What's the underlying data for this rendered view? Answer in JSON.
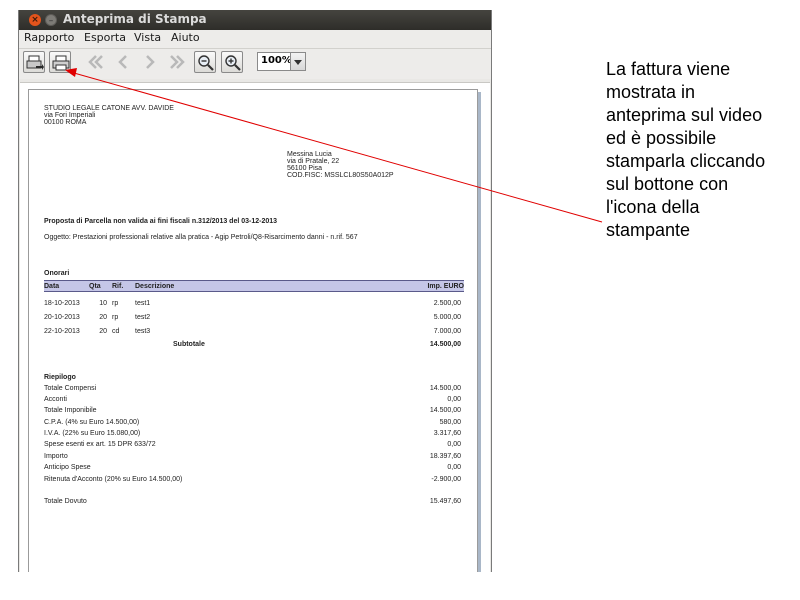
{
  "window": {
    "title": "Anteprima di Stampa"
  },
  "menubar": {
    "items": [
      "Rapporto",
      "Esporta",
      "Vista",
      "Aiuto"
    ]
  },
  "toolbar": {
    "buttons": [
      "export-icon",
      "print-icon",
      "first-page-icon",
      "prev-page-icon",
      "next-page-icon",
      "last-page-icon",
      "zoom-out-icon",
      "zoom-in-icon"
    ],
    "zoom": "100%"
  },
  "document": {
    "sender": {
      "name": "STUDIO LEGALE CATONE AVV. DAVIDE",
      "address": "via Fori Imperiali",
      "city": "00100 ROMA"
    },
    "recipient": {
      "name": "Messina Lucia",
      "address": "via di Pratale, 22",
      "city": "56100 Pisa",
      "tax_code": "COD.FISC: MSSLCL80S50A012P"
    },
    "heading": "Proposta di Parcella non valida ai fini fiscali n.312/2013 del 03-12-2013",
    "subject": "Oggetto: Prestazioni professionali relative alla pratica - Agip Petroli/Q8-Risarcimento danni  - n.rif. 567",
    "onorari": {
      "section_title": "Onorari",
      "columns": [
        "Data",
        "Qta",
        "Rif.",
        "Descrizione",
        "Imp. EURO"
      ],
      "rows": [
        {
          "data": "18-10-2013",
          "qta": "10",
          "rif": "rp",
          "descrizione": "test1",
          "importo": "2.500,00"
        },
        {
          "data": "20-10-2013",
          "qta": "20",
          "rif": "rp",
          "descrizione": "test2",
          "importo": "5.000,00"
        },
        {
          "data": "22-10-2013",
          "qta": "20",
          "rif": "cd",
          "descrizione": "test3",
          "importo": "7.000,00"
        }
      ],
      "subtotal_label": "Subtotale",
      "subtotal_value": "14.500,00"
    },
    "riepilogo": {
      "section_title": "Riepilogo",
      "rows": [
        {
          "label": "Totale Compensi",
          "value": "14.500,00"
        },
        {
          "label": "Acconti",
          "value": "0,00"
        },
        {
          "label": "Totale Imponibile",
          "value": "14.500,00"
        },
        {
          "label": "C.P.A. (4% su Euro 14.500,00)",
          "value": "580,00"
        },
        {
          "label": "I.V.A. (22% su Euro 15.080,00)",
          "value": "3.317,60"
        },
        {
          "label": "Spese esenti ex art. 15 DPR 633/72",
          "value": "0,00"
        },
        {
          "label": "Importo",
          "value": "18.397,60"
        },
        {
          "label": "Anticipo Spese",
          "value": "0,00"
        },
        {
          "label": "Ritenuta d'Acconto (20% su Euro 14.500,00)",
          "value": "-2.900,00"
        }
      ],
      "total_label": "Totale Dovuto",
      "total_value": "15.497,60"
    }
  },
  "annotation": {
    "lines": [
      "La fattura viene",
      "mostrata in",
      "anteprima sul video",
      "ed è possibile",
      "stamparla cliccando",
      "sul bottone con",
      "l'icona della",
      "stampante"
    ],
    "arrow_color": "#e00000"
  }
}
